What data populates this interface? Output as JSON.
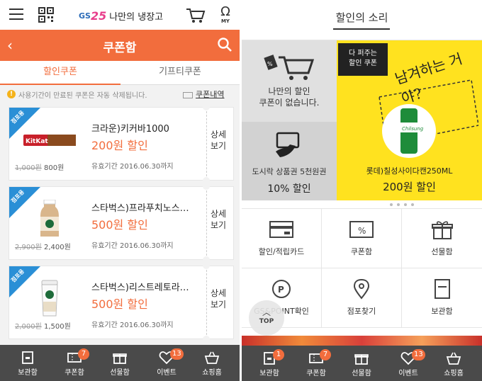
{
  "left": {
    "header": {
      "logo_brand": "GS25",
      "logo_text": "나만의 냉장고",
      "my_label": "MY"
    },
    "orange_bar": {
      "title": "쿠폰함"
    },
    "tabs": [
      {
        "label": "할인쿠폰"
      },
      {
        "label": "기프티쿠폰"
      }
    ],
    "notice": {
      "text": "사용기간이 만료된 쿠폰은 자동 삭제됩니다.",
      "link": "쿠폰내역"
    },
    "coupons": [
      {
        "badge": "점포용",
        "name": "크라운)키커바1000",
        "discount": "200원 할인",
        "old_price": "1,000원",
        "new_price": "800원",
        "expiry": "유효기간 2016.06.30까지",
        "detail": "상세보기"
      },
      {
        "badge": "점포용",
        "name": "스타벅스)프라푸치노스…",
        "discount": "500원 할인",
        "old_price": "2,900원",
        "new_price": "2,400원",
        "expiry": "유효기간 2016.06.30까지",
        "detail": "상세보기"
      },
      {
        "badge": "점포용",
        "name": "스타벅스)리스트레토라…",
        "discount": "500원 할인",
        "old_price": "2,000원",
        "new_price": "1,500원",
        "expiry": "유효기간 2016.06.30까지",
        "detail": "상세보기"
      }
    ],
    "bottom_nav": [
      {
        "label": "보관함",
        "badge": "",
        "icon": "storage-icon"
      },
      {
        "label": "쿠폰함",
        "badge": "7",
        "icon": "coupon-icon"
      },
      {
        "label": "선물함",
        "badge": "",
        "icon": "gift-icon"
      },
      {
        "label": "이벤트",
        "badge": "13",
        "icon": "heart-icon"
      },
      {
        "label": "쇼핑홈",
        "badge": "",
        "icon": "shopping-bag-icon"
      }
    ]
  },
  "right": {
    "title": "할인의 소리",
    "tile_a": {
      "line1": "나만의 할인",
      "line2": "쿠폰이 없습니다."
    },
    "tile_b": {
      "line1": "도시락 상품권 5천원권",
      "line2": "10% 할인"
    },
    "tile_c": {
      "speech_line1": "다 퍼주는",
      "speech_line2": "할인 쿠폰",
      "handwriting": "남겨하는 거야?",
      "product": "롯데)칠성사이다캔250ML",
      "discount": "200원 할인"
    },
    "grid": [
      {
        "label": "할인/적립카드",
        "icon": "card-icon"
      },
      {
        "label": "쿠폰함",
        "icon": "coupon-percent-icon"
      },
      {
        "label": "선물함",
        "icon": "gift-icon"
      },
      {
        "label": "GS&POINT확인",
        "icon": "point-icon"
      },
      {
        "label": "점포찾기",
        "icon": "location-pin-icon"
      },
      {
        "label": "보관함",
        "icon": "storage-box-icon"
      }
    ],
    "top_button": "TOP",
    "bottom_nav": [
      {
        "label": "보관함",
        "badge": "1",
        "icon": "storage-icon"
      },
      {
        "label": "쿠폰함",
        "badge": "7",
        "icon": "coupon-icon"
      },
      {
        "label": "선물함",
        "badge": "",
        "icon": "gift-icon"
      },
      {
        "label": "이벤트",
        "badge": "13",
        "icon": "heart-icon"
      },
      {
        "label": "쇼핑홈",
        "badge": "",
        "icon": "shopping-bag-icon"
      }
    ]
  },
  "colors": {
    "accent": "#f26d3d",
    "nav": "#4a4a4a",
    "yellow": "#ffe21f",
    "badge_blue": "#2a8fd6"
  }
}
